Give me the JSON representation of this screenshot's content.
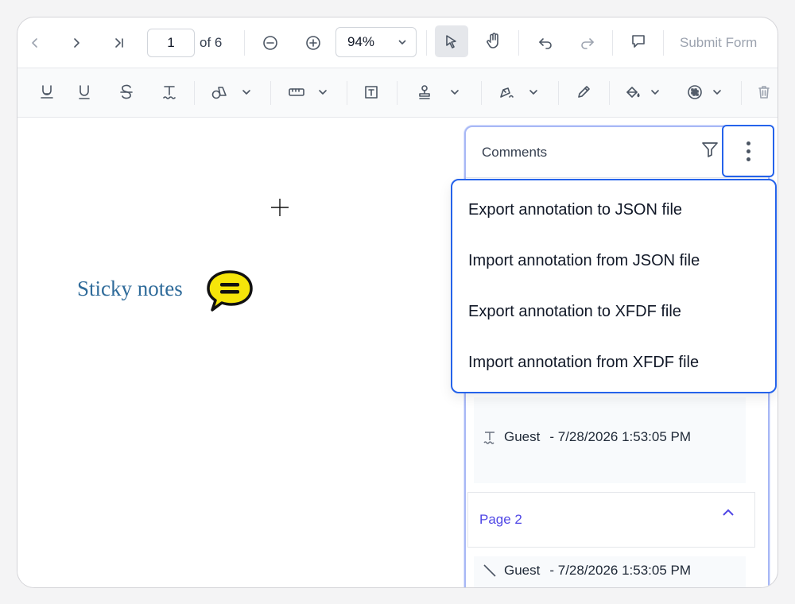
{
  "toolbar": {
    "page_number": "1",
    "page_total_label": "of 6",
    "zoom": "94%",
    "submit_label": "Submit Form"
  },
  "document": {
    "sticky_label": "Sticky notes"
  },
  "comments_panel": {
    "title": "Comments",
    "entries": [
      {
        "author": "Guest",
        "timestamp": "- 7/28/2026 1:53:05 PM",
        "icon": "text-icon"
      },
      {
        "author": "Guest",
        "timestamp": "- 7/28/2026 1:53:05 PM",
        "icon": "line-icon"
      }
    ],
    "page_group_label": "Page 2"
  },
  "menu": {
    "items": [
      "Export annotation to JSON file",
      "Import annotation from JSON file",
      "Export annotation to XFDF file",
      "Import annotation from XFDF file"
    ]
  },
  "colors": {
    "accent": "#2563eb",
    "page_group": "#4f46e5",
    "sticky_text": "#2f6b9a",
    "sticky_fill": "#f5e50a"
  }
}
